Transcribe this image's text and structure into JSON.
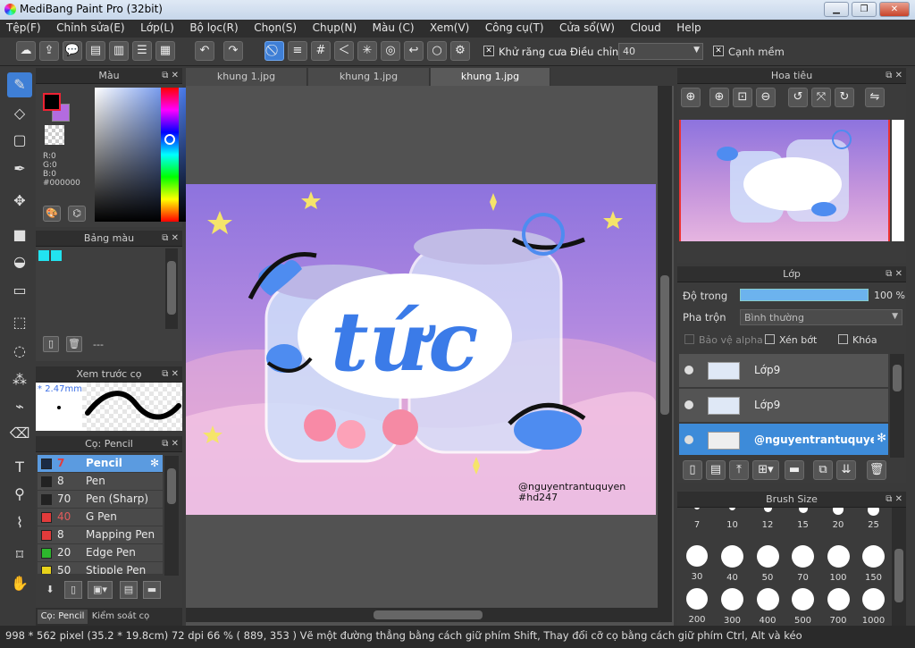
{
  "window": {
    "title": "MediBang Paint Pro (32bit)"
  },
  "menu": [
    "Tệp(F)",
    "Chỉnh sửa(E)",
    "Lớp(L)",
    "Bộ lọc(R)",
    "Chọn(S)",
    "Chụp(N)",
    "Màu (C)",
    "Xem(V)",
    "Công cụ(T)",
    "Cửa sổ(W)",
    "Cloud",
    "Help"
  ],
  "toolbar": {
    "antialias_label": "Khử răng cưa",
    "adjust_label": "Điều chỉnh",
    "adjust_value": "40",
    "soft_edge_label": "Cạnh mềm"
  },
  "color_panel": {
    "title": "Màu",
    "r": "R:0",
    "g": "G:0",
    "b": "B:0",
    "hex": "#000000",
    "primary_color": "#000000",
    "secondary_color": "#b36be0"
  },
  "palette_panel": {
    "title": "Bảng màu",
    "swatches": [
      "#22e3f0",
      "#22e3f0"
    ],
    "footer_text": "---"
  },
  "brush_preview": {
    "title": "Xem trước cọ",
    "size": "2.47mm"
  },
  "brush_panel": {
    "title": "Cọ: Pencil",
    "brushes": [
      {
        "size": "7",
        "name": "Pencil",
        "color": "#1b2b44",
        "selected": true
      },
      {
        "size": "8",
        "name": "Pen",
        "color": "#222222"
      },
      {
        "size": "70",
        "name": "Pen (Sharp)",
        "color": "#222222"
      },
      {
        "size": "40",
        "name": "G Pen",
        "color": "#e23b3b"
      },
      {
        "size": "8",
        "name": "Mapping Pen",
        "color": "#e23b3b"
      },
      {
        "size": "20",
        "name": "Edge Pen",
        "color": "#2db72d"
      },
      {
        "size": "50",
        "name": "Stipple Pen",
        "color": "#e8d21a"
      }
    ],
    "bottom_tabs": [
      "Cọ: Pencil",
      "Kiểm soát cọ"
    ]
  },
  "tabs": [
    "khung 1.jpg",
    "khung 1.jpg",
    "khung 1.jpg"
  ],
  "canvas": {
    "watermark_line1": "@nguyentrantuquyen",
    "watermark_line2": "#hd247",
    "headline": "tức"
  },
  "navigator_panel": {
    "title": "Hoa tiêu"
  },
  "layer_panel": {
    "title": "Lớp",
    "opacity_label": "Độ trong",
    "opacity_value": "100 %",
    "blend_label": "Pha trộn",
    "blend_value": "Bình thường",
    "protect_alpha": "Bảo vệ alpha",
    "clipping": "Xén bớt",
    "lock": "Khóa",
    "layers": [
      {
        "name": "Lớp9"
      },
      {
        "name": "Lớp9"
      },
      {
        "name": "@nguyentrantuquyen",
        "selected": true
      }
    ]
  },
  "brush_size_panel": {
    "title": "Brush Size",
    "sizes": [
      "7",
      "10",
      "12",
      "15",
      "20",
      "25",
      "30",
      "40",
      "50",
      "70",
      "100",
      "150",
      "200",
      "300",
      "400",
      "500",
      "700",
      "1000"
    ]
  },
  "status": {
    "text": "998 * 562 pixel  (35.2 * 19.8cm)  72 dpi  66 %  ( 889, 353 )  Vẽ một đường thẳng bằng cách giữ phím Shift, Thay đổi cỡ cọ bằng cách giữ phím Ctrl, Alt và kéo"
  }
}
